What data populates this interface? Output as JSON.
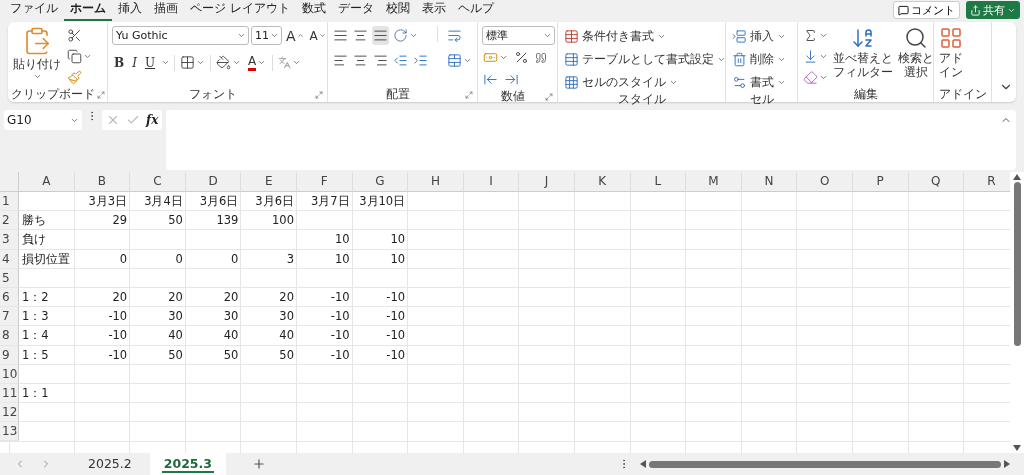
{
  "menu_tabs": [
    {
      "label": "ファイル",
      "selected": false
    },
    {
      "label": "ホーム",
      "selected": true
    },
    {
      "label": "挿入",
      "selected": false
    },
    {
      "label": "描画",
      "selected": false
    },
    {
      "label": "ページ レイアウト",
      "selected": false
    },
    {
      "label": "数式",
      "selected": false
    },
    {
      "label": "データ",
      "selected": false
    },
    {
      "label": "校閲",
      "selected": false
    },
    {
      "label": "表示",
      "selected": false
    },
    {
      "label": "ヘルプ",
      "selected": false
    }
  ],
  "comment_button": "コメント",
  "share_button": "共有",
  "ribbon": {
    "clipboard": {
      "paste": "貼り付け",
      "label": "クリップボード"
    },
    "font": {
      "family": "Yu Gothic",
      "size": "11",
      "grow": "A",
      "shrink": "A",
      "bold": "B",
      "italic": "I",
      "underline": "U",
      "color_letter": "A",
      "label": "フォント"
    },
    "alignment": {
      "label": "配置"
    },
    "number": {
      "format": "標準",
      "label": "数値"
    },
    "styles": {
      "items": [
        "条件付き書式",
        "テーブルとして書式設定",
        "セルのスタイル"
      ],
      "label": "スタイル"
    },
    "cells": {
      "items": [
        "挿入",
        "削除",
        "書式"
      ],
      "label": "セル"
    },
    "editing": {
      "sort": [
        "並べ替えと",
        "フィルター"
      ],
      "find": [
        "検索と",
        "選択"
      ],
      "label": "編集"
    },
    "addins": {
      "button": [
        "アド",
        "イン"
      ],
      "label": "アドイン"
    }
  },
  "name_box": "G10",
  "formula_fx": "fx",
  "columns": [
    "A",
    "B",
    "C",
    "D",
    "E",
    "F",
    "G",
    "H",
    "I",
    "J",
    "K",
    "L",
    "M",
    "N",
    "O",
    "P",
    "Q",
    "R"
  ],
  "rows": [
    {
      "label": "1",
      "cells": [
        {},
        {
          "text": "3月3日"
        },
        {
          "text": "3月4日"
        },
        {
          "text": "3月6日"
        },
        {
          "text": "3月6日"
        },
        {
          "text": "3月7日"
        },
        {
          "text": "3月10日"
        }
      ]
    },
    {
      "label": "2",
      "cells": [
        {
          "text": "勝ち"
        },
        {
          "text": "29"
        },
        {
          "text": "50"
        },
        {
          "text": "139"
        },
        {
          "text": "100"
        }
      ]
    },
    {
      "label": "3",
      "cells": [
        {
          "text": "負け"
        },
        {},
        {},
        {},
        {},
        {
          "text": "10"
        },
        {
          "text": "10"
        }
      ]
    },
    {
      "label": "4",
      "cells": [
        {
          "text": "損切位置"
        },
        {
          "text": "0"
        },
        {
          "text": "0"
        },
        {
          "text": "0"
        },
        {
          "text": "3"
        },
        {
          "text": "10"
        },
        {
          "text": "10"
        }
      ]
    },
    {
      "label": "5",
      "cells": []
    },
    {
      "label": "6",
      "cells": [
        {
          "text": "1：2"
        },
        {
          "text": "20"
        },
        {
          "text": "20"
        },
        {
          "text": "20"
        },
        {
          "text": "20"
        },
        {
          "text": "-10"
        },
        {
          "text": "-10"
        }
      ]
    },
    {
      "label": "7",
      "cells": [
        {
          "text": "1：3"
        },
        {
          "text": "-10"
        },
        {
          "text": "30"
        },
        {
          "text": "30"
        },
        {
          "text": "30"
        },
        {
          "text": "-10"
        },
        {
          "text": "-10"
        }
      ]
    },
    {
      "label": "8",
      "cells": [
        {
          "text": "1：4"
        },
        {
          "text": "-10"
        },
        {
          "text": "40"
        },
        {
          "text": "40"
        },
        {
          "text": "40"
        },
        {
          "text": "-10"
        },
        {
          "text": "-10"
        }
      ]
    },
    {
      "label": "9",
      "cells": [
        {
          "text": "1：5"
        },
        {
          "text": "-10"
        },
        {
          "text": "50"
        },
        {
          "text": "50"
        },
        {
          "text": "50"
        },
        {
          "text": "-10"
        },
        {
          "text": "-10"
        }
      ]
    },
    {
      "label": "10",
      "cells": []
    },
    {
      "label": "11",
      "cells": [
        {
          "text": "1：1"
        }
      ]
    },
    {
      "label": "12",
      "cells": []
    },
    {
      "label": "13",
      "cells": []
    }
  ],
  "sheet_tabs": [
    {
      "label": "2025.2",
      "selected": false
    },
    {
      "label": "2025.3",
      "selected": true
    }
  ]
}
